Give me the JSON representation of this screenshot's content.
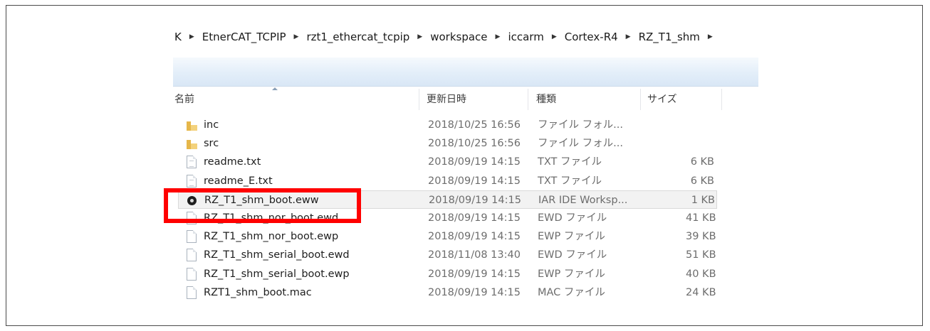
{
  "breadcrumb": {
    "items": [
      "K",
      "EtnerCAT_TCPIP",
      "rzt1_ethercat_tcpip",
      "workspace",
      "iccarm",
      "Cortex-R4",
      "RZ_T1_shm"
    ],
    "separator": "▶"
  },
  "columns": {
    "name": "名前",
    "date": "更新日時",
    "type": "種類",
    "size": "サイズ"
  },
  "files": [
    {
      "name": "inc",
      "date": "2018/10/25 16:56",
      "type": "ファイル フォル...",
      "size": "",
      "icon": "folder-icon"
    },
    {
      "name": "src",
      "date": "2018/10/25 16:56",
      "type": "ファイル フォル...",
      "size": "",
      "icon": "folder-icon"
    },
    {
      "name": "readme.txt",
      "date": "2018/09/19 14:15",
      "type": "TXT ファイル",
      "size": "6 KB",
      "icon": "text-file-icon"
    },
    {
      "name": "readme_E.txt",
      "date": "2018/09/19 14:15",
      "type": "TXT ファイル",
      "size": "6 KB",
      "icon": "text-file-icon"
    },
    {
      "name": "RZ_T1_shm_boot.eww",
      "date": "2018/09/19 14:15",
      "type": "IAR IDE Worksp...",
      "size": "1 KB",
      "icon": "iar-workspace-icon",
      "selected": true
    },
    {
      "name": "RZ_T1_shm_nor_boot.ewd",
      "date": "2018/09/19 14:15",
      "type": "EWD ファイル",
      "size": "41 KB",
      "icon": "file-icon"
    },
    {
      "name": "RZ_T1_shm_nor_boot.ewp",
      "date": "2018/09/19 14:15",
      "type": "EWP ファイル",
      "size": "39 KB",
      "icon": "file-icon"
    },
    {
      "name": "RZ_T1_shm_serial_boot.ewd",
      "date": "2018/11/08 13:40",
      "type": "EWD ファイル",
      "size": "51 KB",
      "icon": "file-icon"
    },
    {
      "name": "RZ_T1_shm_serial_boot.ewp",
      "date": "2018/09/19 14:15",
      "type": "EWP ファイル",
      "size": "40 KB",
      "icon": "file-icon"
    },
    {
      "name": "RZT1_shm_boot.mac",
      "date": "2018/09/19 14:15",
      "type": "MAC ファイル",
      "size": "24 KB",
      "icon": "file-icon"
    }
  ],
  "colors": {
    "highlight": "#ff0000",
    "toolbar_gradient_top": "#f5f9fd",
    "toolbar_gradient_bottom": "#d9e7f6",
    "selection_background": "#f2f2f2",
    "folder": "#e6b74a"
  }
}
